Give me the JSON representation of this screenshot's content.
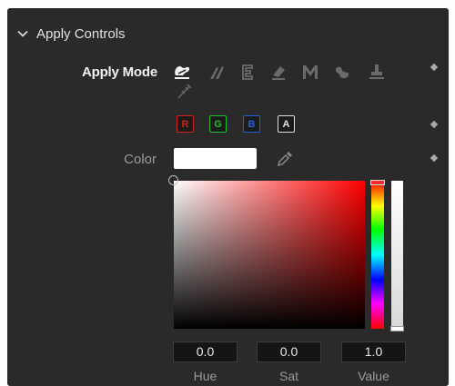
{
  "section": {
    "title": "Apply Controls",
    "expanded": true
  },
  "apply_mode": {
    "label": "Apply Mode",
    "modes": [
      {
        "name": "color",
        "selected": true
      },
      {
        "name": "clone",
        "selected": false
      },
      {
        "name": "emboss",
        "selected": false
      },
      {
        "name": "erase",
        "selected": false
      },
      {
        "name": "merge",
        "selected": false
      },
      {
        "name": "smear",
        "selected": false
      },
      {
        "name": "stamp",
        "selected": false
      },
      {
        "name": "wire",
        "selected": false
      }
    ]
  },
  "channels": [
    {
      "label": "R",
      "color": "#d42020"
    },
    {
      "label": "G",
      "color": "#20c030"
    },
    {
      "label": "B",
      "color": "#2060d8"
    },
    {
      "label": "A",
      "color": "#e0e0e0"
    }
  ],
  "color": {
    "label": "Color",
    "swatch_color": "#ffffff"
  },
  "picker": {
    "hue": {
      "label": "Hue",
      "value": "0.0"
    },
    "sat": {
      "label": "Sat",
      "value": "0.0"
    },
    "value": {
      "label": "Value",
      "value": "1.0"
    }
  },
  "colors": {
    "panel_bg": "#2a2a2a",
    "text_primary": "#f1f1f1",
    "text_secondary": "#9a9a9a",
    "icon_dim": "#6a6a6a"
  }
}
